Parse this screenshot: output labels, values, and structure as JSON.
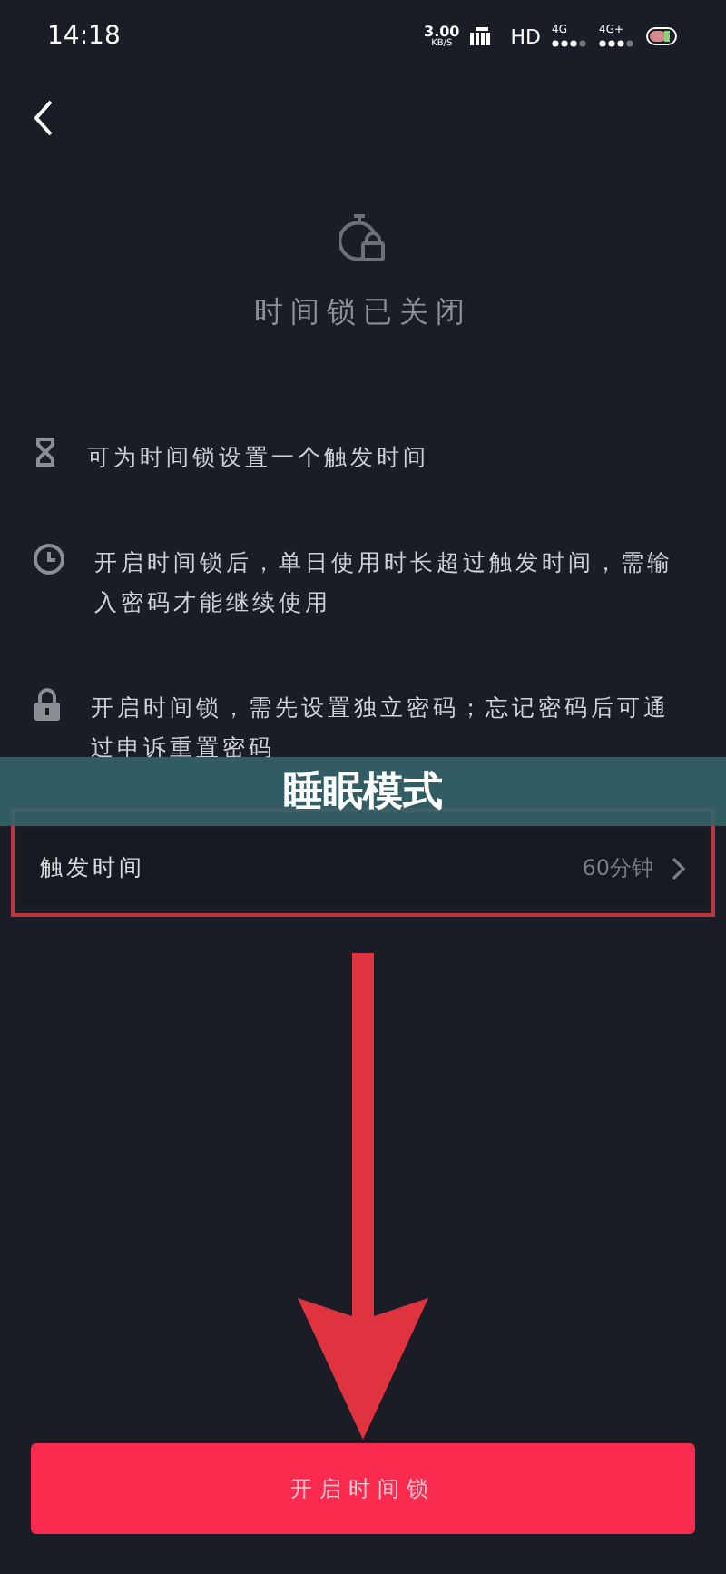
{
  "status_bar": {
    "time": "14:18",
    "speed": "3.00",
    "speed_unit": "KB/S",
    "hd": "HD",
    "network_1": "4G",
    "network_2": "4G+"
  },
  "title": "时间锁已关闭",
  "features": [
    {
      "kind": "hourglass",
      "text": "可为时间锁设置一个触发时间"
    },
    {
      "kind": "clock",
      "text": "开启时间锁后，单日使用时长超过触发时间，需输入密码才能继续使用"
    },
    {
      "kind": "lock",
      "text": "开启时间锁，需先设置独立密码；忘记密码后可通过申诉重置密码"
    }
  ],
  "banner": "睡眠模式",
  "setting": {
    "label": "触发时间",
    "value": "60分钟",
    "highlighted": true
  },
  "button": "开启时间锁"
}
